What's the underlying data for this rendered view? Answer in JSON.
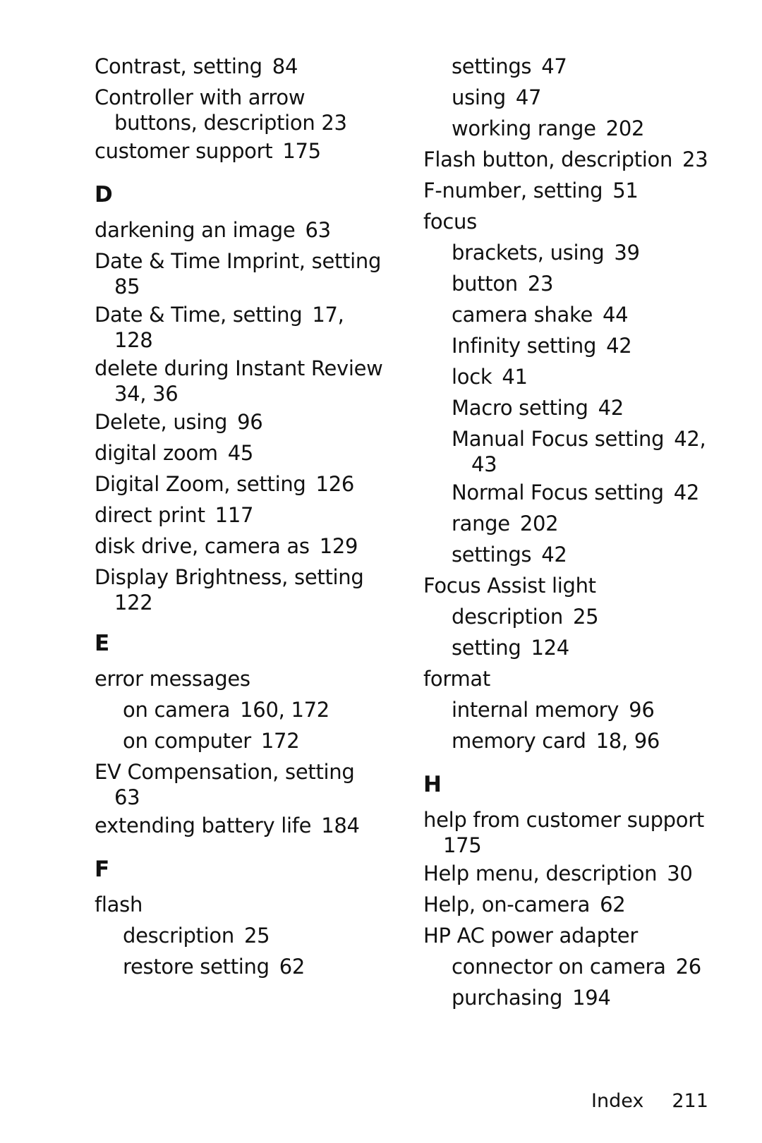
{
  "left_column": [
    {
      "type": "entry",
      "level": 1,
      "text": "Contrast, setting",
      "pages": "84"
    },
    {
      "type": "entry",
      "level": 1,
      "text": "Controller with arrow",
      "cont": "buttons, description  23"
    },
    {
      "type": "entry",
      "level": 1,
      "text": "customer support",
      "pages": "175"
    },
    {
      "type": "letter",
      "text": "D"
    },
    {
      "type": "entry",
      "level": 1,
      "text": "darkening an image",
      "pages": "63"
    },
    {
      "type": "entry",
      "level": 1,
      "text": "Date & Time Imprint, setting",
      "cont": "85"
    },
    {
      "type": "entry",
      "level": 1,
      "text": "Date & Time, setting",
      "pages": "17,",
      "cont": "128"
    },
    {
      "type": "entry",
      "level": 1,
      "text": "delete during Instant Review",
      "cont": "34,  36"
    },
    {
      "type": "entry",
      "level": 1,
      "text": "Delete, using",
      "pages": "96"
    },
    {
      "type": "entry",
      "level": 1,
      "text": "digital zoom",
      "pages": "45"
    },
    {
      "type": "entry",
      "level": 1,
      "text": "Digital Zoom, setting",
      "pages": "126"
    },
    {
      "type": "entry",
      "level": 1,
      "text": "direct print",
      "pages": "117"
    },
    {
      "type": "entry",
      "level": 1,
      "text": "disk drive, camera as",
      "pages": "129"
    },
    {
      "type": "entry",
      "level": 1,
      "text": "Display Brightness, setting",
      "cont": "122"
    },
    {
      "type": "letter",
      "text": "E"
    },
    {
      "type": "entry",
      "level": 1,
      "text": "error messages"
    },
    {
      "type": "entry",
      "level": 2,
      "text": "on camera",
      "pages": "160,  172"
    },
    {
      "type": "entry",
      "level": 2,
      "text": "on computer",
      "pages": "172"
    },
    {
      "type": "entry",
      "level": 1,
      "text": "EV Compensation, setting",
      "cont": "63"
    },
    {
      "type": "entry",
      "level": 1,
      "text": "extending battery life",
      "pages": "184"
    },
    {
      "type": "letter",
      "text": "F"
    },
    {
      "type": "entry",
      "level": 1,
      "text": "flash"
    },
    {
      "type": "entry",
      "level": 2,
      "text": "description",
      "pages": "25"
    },
    {
      "type": "entry",
      "level": 2,
      "text": "restore setting",
      "pages": "62"
    }
  ],
  "right_column": [
    {
      "type": "entry",
      "level": 2,
      "text": "settings",
      "pages": "47"
    },
    {
      "type": "entry",
      "level": 2,
      "text": "using",
      "pages": "47"
    },
    {
      "type": "entry",
      "level": 2,
      "text": "working range",
      "pages": "202"
    },
    {
      "type": "entry",
      "level": 1,
      "text": "Flash button, description",
      "pages": "23"
    },
    {
      "type": "entry",
      "level": 1,
      "text": "F-number, setting",
      "pages": "51"
    },
    {
      "type": "entry",
      "level": 1,
      "text": "focus"
    },
    {
      "type": "entry",
      "level": 2,
      "text": "brackets, using",
      "pages": "39"
    },
    {
      "type": "entry",
      "level": 2,
      "text": "button",
      "pages": "23"
    },
    {
      "type": "entry",
      "level": 2,
      "text": "camera shake",
      "pages": "44"
    },
    {
      "type": "entry",
      "level": 2,
      "text": "Infinity setting",
      "pages": "42"
    },
    {
      "type": "entry",
      "level": 2,
      "text": "lock",
      "pages": "41"
    },
    {
      "type": "entry",
      "level": 2,
      "text": "Macro setting",
      "pages": "42"
    },
    {
      "type": "entry",
      "level": 2,
      "text": "Manual Focus setting",
      "pages": "42,",
      "cont": "43"
    },
    {
      "type": "entry",
      "level": 2,
      "text": "Normal Focus setting",
      "pages": "42"
    },
    {
      "type": "entry",
      "level": 2,
      "text": "range",
      "pages": "202"
    },
    {
      "type": "entry",
      "level": 2,
      "text": "settings",
      "pages": "42"
    },
    {
      "type": "entry",
      "level": 1,
      "text": "Focus Assist light"
    },
    {
      "type": "entry",
      "level": 2,
      "text": "description",
      "pages": "25"
    },
    {
      "type": "entry",
      "level": 2,
      "text": "setting",
      "pages": "124"
    },
    {
      "type": "entry",
      "level": 1,
      "text": "format"
    },
    {
      "type": "entry",
      "level": 2,
      "text": "internal memory",
      "pages": "96"
    },
    {
      "type": "entry",
      "level": 2,
      "text": "memory card",
      "pages": "18,  96"
    },
    {
      "type": "letter",
      "text": "H"
    },
    {
      "type": "entry",
      "level": 1,
      "text": "help from customer support",
      "cont": "175"
    },
    {
      "type": "entry",
      "level": 1,
      "text": "Help menu, description",
      "pages": "30"
    },
    {
      "type": "entry",
      "level": 1,
      "text": "Help, on-camera",
      "pages": "62"
    },
    {
      "type": "entry",
      "level": 1,
      "text": "HP AC power adapter"
    },
    {
      "type": "entry",
      "level": 2,
      "text": "connector on camera",
      "pages": "26"
    },
    {
      "type": "entry",
      "level": 2,
      "text": "purchasing",
      "pages": "194"
    }
  ],
  "footer": {
    "section": "Index",
    "page_number": "211"
  }
}
